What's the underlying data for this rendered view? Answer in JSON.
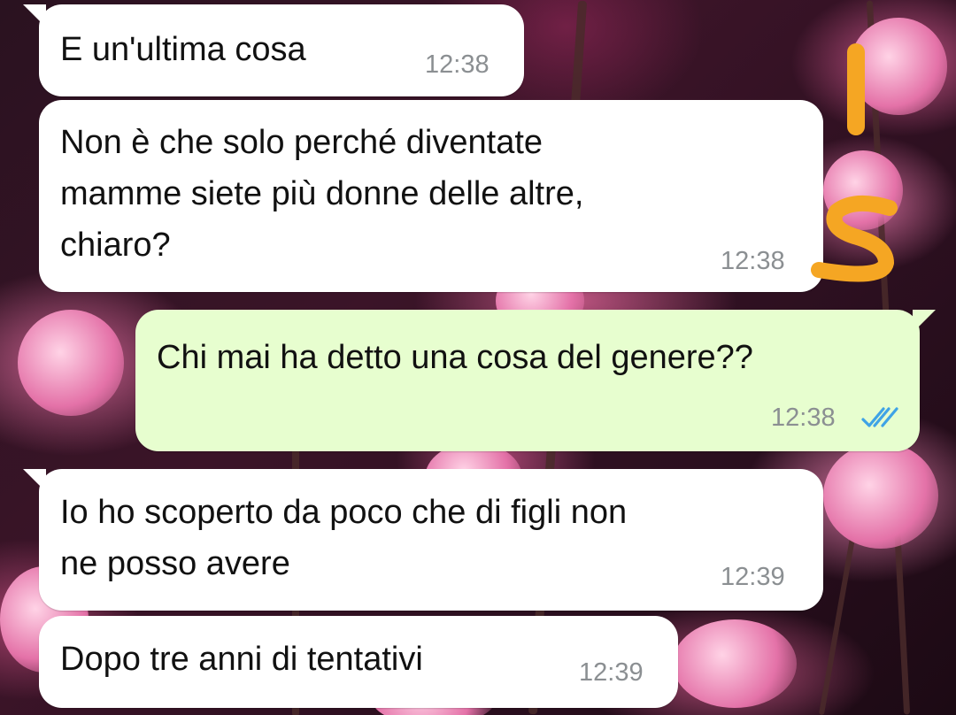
{
  "colors": {
    "incoming_bubble": "#ffffff",
    "outgoing_bubble": "#e7fecf",
    "timestamp": "#8b8f92",
    "read_ticks": "#3fa3e6",
    "annotation_marker": "#f5a623"
  },
  "messages": [
    {
      "direction": "incoming",
      "text": "E un'ultima cosa",
      "time": "12:38"
    },
    {
      "direction": "incoming",
      "text": "Non è che solo perché diventate\nmamme siete più donne delle altre,\nchiaro?",
      "time": "12:38"
    },
    {
      "direction": "outgoing",
      "text": "Chi mai ha detto una cosa del genere??",
      "time": "12:38",
      "status_icon": "double-check-read-icon"
    },
    {
      "direction": "incoming",
      "text": "Io ho scoperto da poco che di figli non\nne posso avere",
      "time": "12:39"
    },
    {
      "direction": "incoming",
      "text": "Dopo tre anni di tentativi",
      "time": "12:39"
    }
  ],
  "annotation": {
    "text": "IS",
    "description_icon": "handwritten-marker"
  }
}
